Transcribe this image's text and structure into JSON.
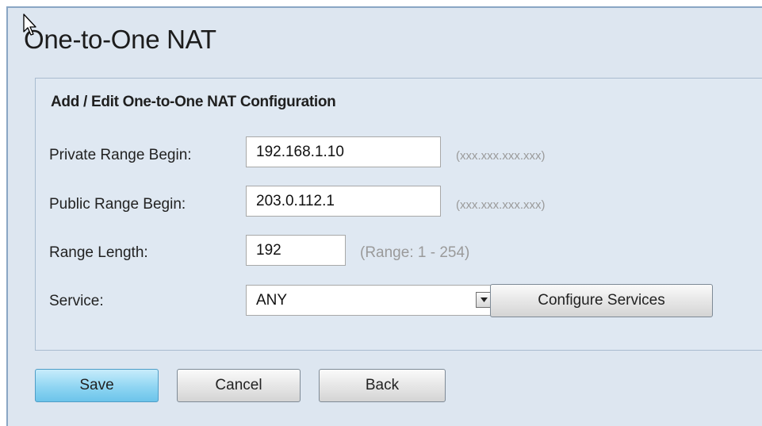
{
  "page": {
    "title": "One-to-One NAT"
  },
  "config": {
    "section_title": "Add / Edit One-to-One NAT Configuration",
    "private_range_begin": {
      "label": "Private Range Begin:",
      "value": "192.168.1.10",
      "hint": "(xxx.xxx.xxx.xxx)"
    },
    "public_range_begin": {
      "label": "Public Range Begin:",
      "value": "203.0.112.1",
      "hint": "(xxx.xxx.xxx.xxx)"
    },
    "range_length": {
      "label": "Range Length:",
      "value": "192",
      "hint": "(Range: 1 - 254)"
    },
    "service": {
      "label": "Service:",
      "selected": "ANY",
      "configure_label": "Configure Services"
    }
  },
  "actions": {
    "save_label": "Save",
    "cancel_label": "Cancel",
    "back_label": "Back"
  },
  "colors": {
    "frame_bg": "#dde6f0",
    "save_accent": "#8fd5f2"
  },
  "icons": {
    "cursor": "mouse-pointer-icon",
    "dropdown": "chevron-down-icon"
  }
}
